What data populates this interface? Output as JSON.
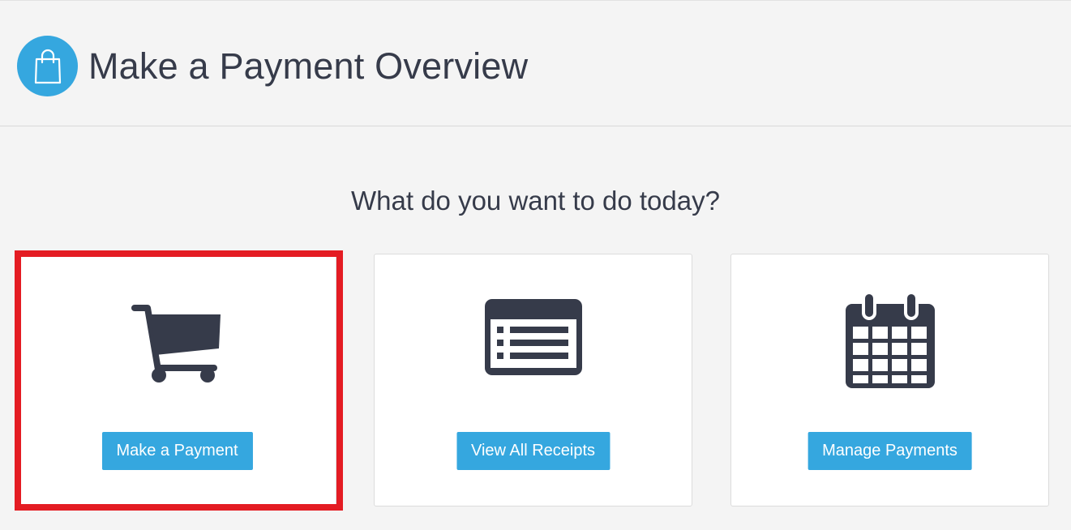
{
  "header": {
    "title": "Make a Payment Overview",
    "icon": "shopping-bag-icon"
  },
  "main": {
    "question": "What do you want to do today?",
    "cards": [
      {
        "icon": "shopping-cart-icon",
        "button_label": "Make a Payment",
        "highlighted": true
      },
      {
        "icon": "receipt-list-icon",
        "button_label": "View All Receipts",
        "highlighted": false
      },
      {
        "icon": "calendar-icon",
        "button_label": "Manage Payments",
        "highlighted": false
      }
    ]
  },
  "colors": {
    "accent": "#35a7df",
    "text": "#363b4a",
    "background": "#f4f4f4",
    "highlight": "#e41c23"
  }
}
